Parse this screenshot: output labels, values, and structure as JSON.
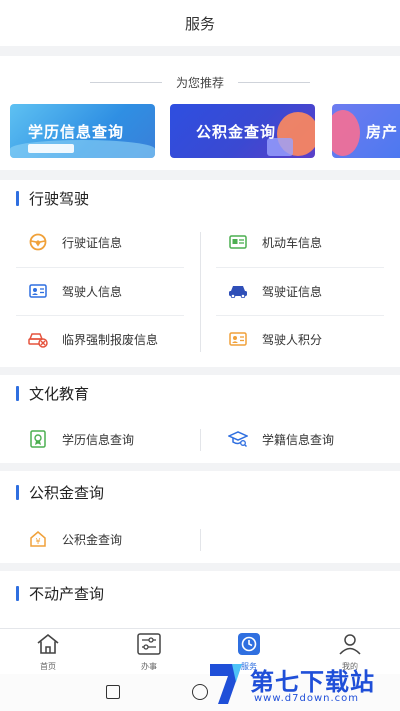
{
  "header": {
    "title": "服务"
  },
  "recommend": {
    "heading": "为您推荐",
    "banners": [
      {
        "label": "学历信息查询"
      },
      {
        "label": "公积金查询"
      },
      {
        "label": "房产"
      }
    ]
  },
  "sections": {
    "driving": {
      "title": "行驶驾驶",
      "items": [
        {
          "label": "行驶证信息",
          "icon": "steering-wheel-icon"
        },
        {
          "label": "机动车信息",
          "icon": "vehicle-card-icon"
        },
        {
          "label": "驾驶人信息",
          "icon": "id-card-icon"
        },
        {
          "label": "驾驶证信息",
          "icon": "car-icon"
        },
        {
          "label": "临界强制报废信息",
          "icon": "car-scrap-icon"
        },
        {
          "label": "驾驶人积分",
          "icon": "points-card-icon"
        }
      ]
    },
    "education": {
      "title": "文化教育",
      "items": [
        {
          "label": "学历信息查询",
          "icon": "certificate-icon"
        },
        {
          "label": "学籍信息查询",
          "icon": "graduation-cap-icon"
        }
      ]
    },
    "fund": {
      "title": "公积金查询",
      "items": [
        {
          "label": "公积金查询",
          "icon": "house-yuan-icon"
        }
      ]
    },
    "realestate": {
      "title": "不动产查询"
    }
  },
  "tabbar": {
    "tabs": [
      {
        "label": "首页",
        "icon": "home-icon"
      },
      {
        "label": "办事",
        "icon": "sliders-icon"
      },
      {
        "label": "服务",
        "icon": "clock-icon"
      },
      {
        "label": "我的",
        "icon": "user-icon"
      }
    ]
  },
  "watermark": {
    "name": "第七下载站",
    "url": "www.d7down.com"
  },
  "colors": {
    "accent": "#2f6fe0",
    "icon_orange": "#f0a13a",
    "icon_green": "#4caf50",
    "icon_blue": "#2f6fe0",
    "icon_red": "#e5533d"
  }
}
